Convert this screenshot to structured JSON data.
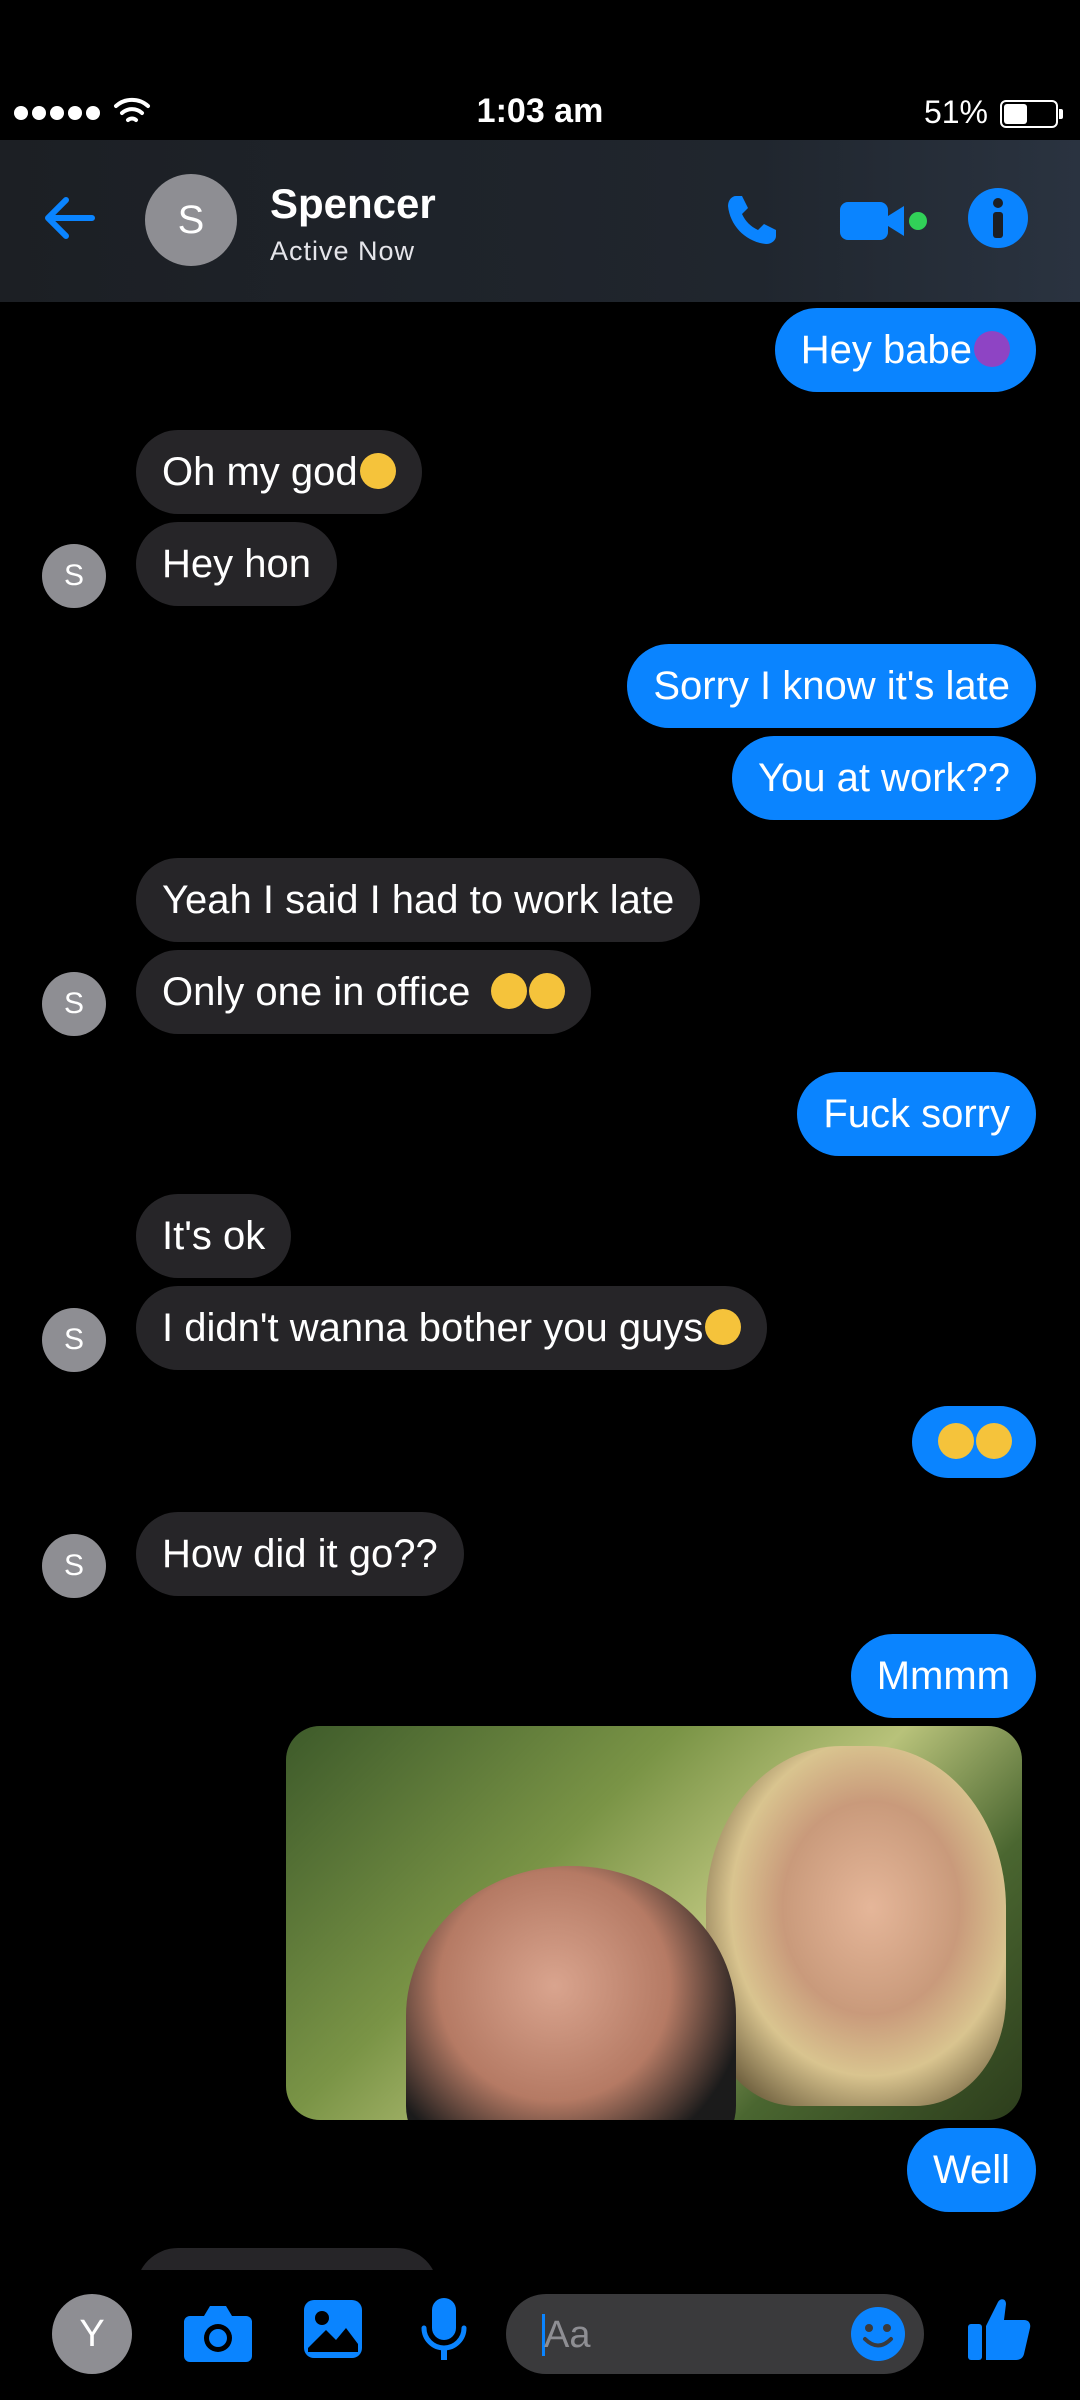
{
  "status_bar": {
    "time": "1:03 am",
    "battery_pct_text": "51%",
    "battery_level": 0.51,
    "signal_bars": 5
  },
  "header": {
    "avatar_letter": "S",
    "contact_name": "Spencer",
    "contact_status": "Active Now",
    "accent_color": "#0a84ff",
    "online_color": "#31d158"
  },
  "messages": [
    {
      "from": "me",
      "text": "Hey babe",
      "emoji": "devil"
    },
    {
      "from": "them",
      "text": "Oh my god",
      "emoji": "smirk"
    },
    {
      "from": "them",
      "text": "Hey hon"
    },
    {
      "from": "me",
      "text": "Sorry I know it's late"
    },
    {
      "from": "me",
      "text": "You at work??"
    },
    {
      "from": "them",
      "text": "Yeah I said I had to work late"
    },
    {
      "from": "them",
      "text": "Only one in office",
      "emoji": "rofl-rofl"
    },
    {
      "from": "me",
      "text": "Fuck sorry"
    },
    {
      "from": "them",
      "text": "It's ok"
    },
    {
      "from": "them",
      "text": "I didn't wanna bother you guys",
      "emoji": "wink"
    },
    {
      "from": "me",
      "text": "",
      "emoji": "rofl-rofl"
    },
    {
      "from": "them",
      "text": "How did it go??"
    },
    {
      "from": "me",
      "text": "Mmmm"
    },
    {
      "from": "me",
      "type": "image",
      "description_icon": "photo-attachment"
    },
    {
      "from": "me",
      "text": "Well"
    }
  ],
  "them_avatar_letter": "S",
  "composer": {
    "avatar_letter": "Y",
    "placeholder": "Aa",
    "value": ""
  },
  "icons": {
    "back": "arrow-left-icon",
    "call": "phone-icon",
    "video": "video-camera-icon",
    "info": "info-icon",
    "camera": "camera-icon",
    "gallery": "image-icon",
    "mic": "microphone-icon",
    "emoji": "smiley-icon",
    "like": "thumbs-up-icon"
  }
}
